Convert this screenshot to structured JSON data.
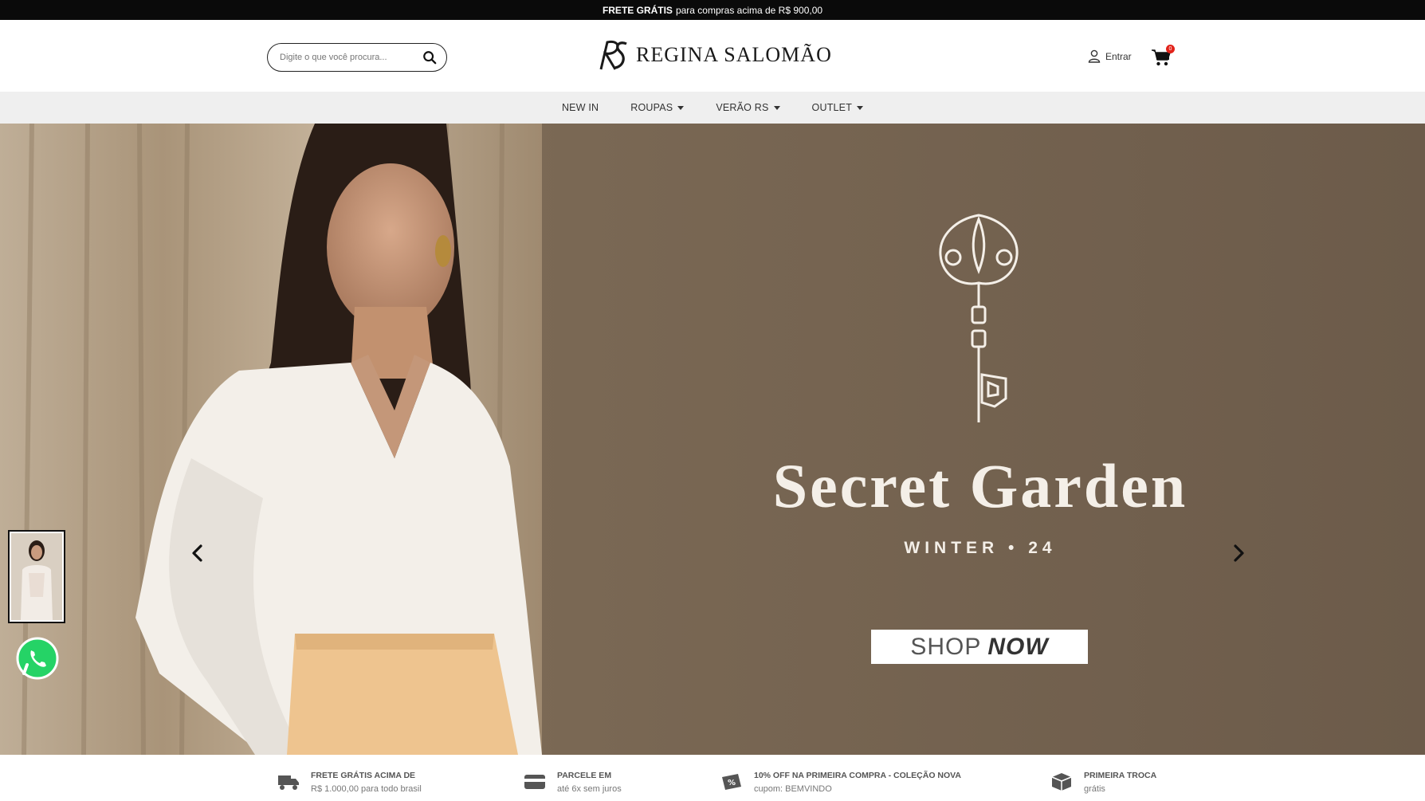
{
  "topbar": {
    "bold": "FRETE GRÁTIS",
    "text": "para compras acima de R$ 900,00"
  },
  "header": {
    "search_placeholder": "Digite o que você procura...",
    "brand": "REGINA SALOMÃO",
    "account_label": "Entrar",
    "cart_count": "0"
  },
  "nav": {
    "items": [
      {
        "label": "NEW IN",
        "dropdown": false
      },
      {
        "label": "ROUPAS",
        "dropdown": true
      },
      {
        "label": "VERÃO RS",
        "dropdown": true
      },
      {
        "label": "OUTLET",
        "dropdown": true
      }
    ]
  },
  "hero": {
    "title": "Secret Garden",
    "subtitle": "WINTER • 24",
    "cta_light": "SHOP",
    "cta_bold": "NOW"
  },
  "features": [
    {
      "icon": "truck-icon",
      "title": "FRETE GRÁTIS ACIMA DE",
      "text": "R$ 1.000,00 para todo brasil"
    },
    {
      "icon": "card-icon",
      "title": "PARCELE EM",
      "text": "até 6x sem juros"
    },
    {
      "icon": "discount-ticket-icon",
      "title": "10% OFF NA PRIMEIRA COMPRA - COLEÇÃO NOVA",
      "text": "cupom: BEMVINDO"
    },
    {
      "icon": "box-icon",
      "title": "PRIMEIRA TROCA",
      "text": "grátis"
    }
  ],
  "colors": {
    "topbar": "#0a0a0a",
    "nav_bg": "#efefef",
    "hero_bg": "#7b6a58",
    "badge": "#e2231a",
    "whatsapp": "#25d366"
  }
}
